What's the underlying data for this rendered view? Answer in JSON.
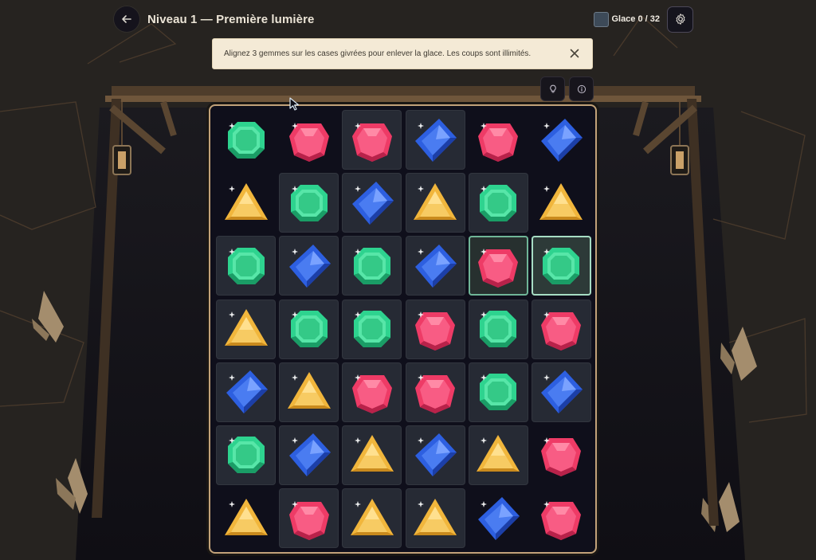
{
  "header": {
    "title": "Niveau 1 — Première lumière",
    "back_icon": "arrow-left-icon",
    "ice_counter": "Glace 0 / 32",
    "ice_cleared": 0,
    "ice_total": 32,
    "settings_icon": "gear-icon"
  },
  "toast": {
    "message": "Alignez 3 gemmes sur les cases givrées pour enlever la glace. Les coups sont illimités.",
    "close_icon": "close-icon"
  },
  "tools": {
    "hint_icon": "lightbulb-icon",
    "info_icon": "info-icon"
  },
  "board": {
    "rows": 7,
    "cols": 6,
    "legend": {
      "G": "green-gem",
      "R": "red-gem",
      "B": "blue-gem",
      "Y": "yellow-gem"
    },
    "gems": [
      [
        "G",
        "R",
        "R",
        "B",
        "R",
        "B"
      ],
      [
        "Y",
        "G",
        "B",
        "Y",
        "G",
        "Y"
      ],
      [
        "G",
        "B",
        "G",
        "B",
        "R",
        "G"
      ],
      [
        "Y",
        "G",
        "G",
        "R",
        "G",
        "R"
      ],
      [
        "B",
        "Y",
        "R",
        "R",
        "G",
        "B"
      ],
      [
        "G",
        "B",
        "Y",
        "B",
        "Y",
        "R"
      ],
      [
        "Y",
        "R",
        "Y",
        "Y",
        "B",
        "R"
      ]
    ],
    "ice": [
      [
        0,
        0,
        1,
        1,
        0,
        0
      ],
      [
        0,
        1,
        1,
        1,
        1,
        0
      ],
      [
        1,
        1,
        1,
        1,
        1,
        1
      ],
      [
        1,
        1,
        1,
        1,
        1,
        1
      ],
      [
        1,
        1,
        1,
        1,
        1,
        1
      ],
      [
        1,
        1,
        1,
        1,
        1,
        0
      ],
      [
        0,
        1,
        1,
        1,
        0,
        0
      ]
    ],
    "selected": [
      [
        2,
        4
      ],
      [
        2,
        5
      ]
    ]
  },
  "colors": {
    "green": "#2ed38f",
    "red": "#ee3b66",
    "blue": "#2d5fe0",
    "yellow": "#f1b63c",
    "board_border": "#c2a279",
    "toast_bg": "#f4ead6"
  }
}
